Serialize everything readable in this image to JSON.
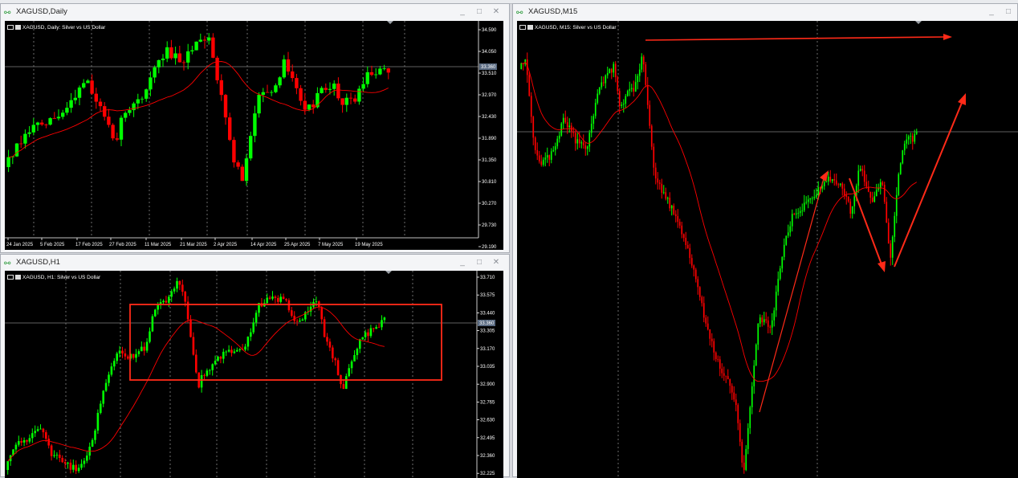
{
  "windows": {
    "daily": {
      "title": "XAGUSD,Daily",
      "chart_label": "XAGUSD, Daily:  Silver vs US Dollar",
      "price_labels": [
        "34.590",
        "34.050",
        "33.510",
        "32.970",
        "32.430",
        "31.890",
        "31.350",
        "30.810",
        "30.270",
        "29.730",
        "29.190",
        "28.650"
      ],
      "current_price": "33.360",
      "date_labels": [
        "24 Jan 2025",
        "5 Feb 2025",
        "17 Feb 2025",
        "27 Feb 2025",
        "11 Mar 2025",
        "21 Mar 2025",
        "2 Apr 2025",
        "14 Apr 2025",
        "25 Apr 2025",
        "7 May 2025",
        "19 May 2025"
      ]
    },
    "h1": {
      "title": "XAGUSD,H1",
      "chart_label": "XAGUSD, H1:  Silver vs US Dollar",
      "price_labels": [
        "33.710",
        "33.575",
        "33.440",
        "33.305",
        "33.170",
        "33.035",
        "32.900",
        "32.765",
        "32.630",
        "32.495",
        "32.360",
        "32.225"
      ],
      "current_price": "33.360"
    },
    "m15": {
      "title": "XAGUSD,M15",
      "chart_label": "XAGUSD, M15:  Silver vs US Dollar"
    }
  },
  "colors": {
    "bull": "#00ff00",
    "bear": "#ff0000",
    "ma_line": "#ff0000",
    "annotation": "#ff2a18",
    "background": "#000000",
    "bid_line": "#7f7f7f",
    "grid": "#ffffff"
  },
  "icons": {
    "window_icon": "chart-candles-icon",
    "minimize": "minimize-icon",
    "maximize": "maximize-icon",
    "close": "close-icon"
  }
}
